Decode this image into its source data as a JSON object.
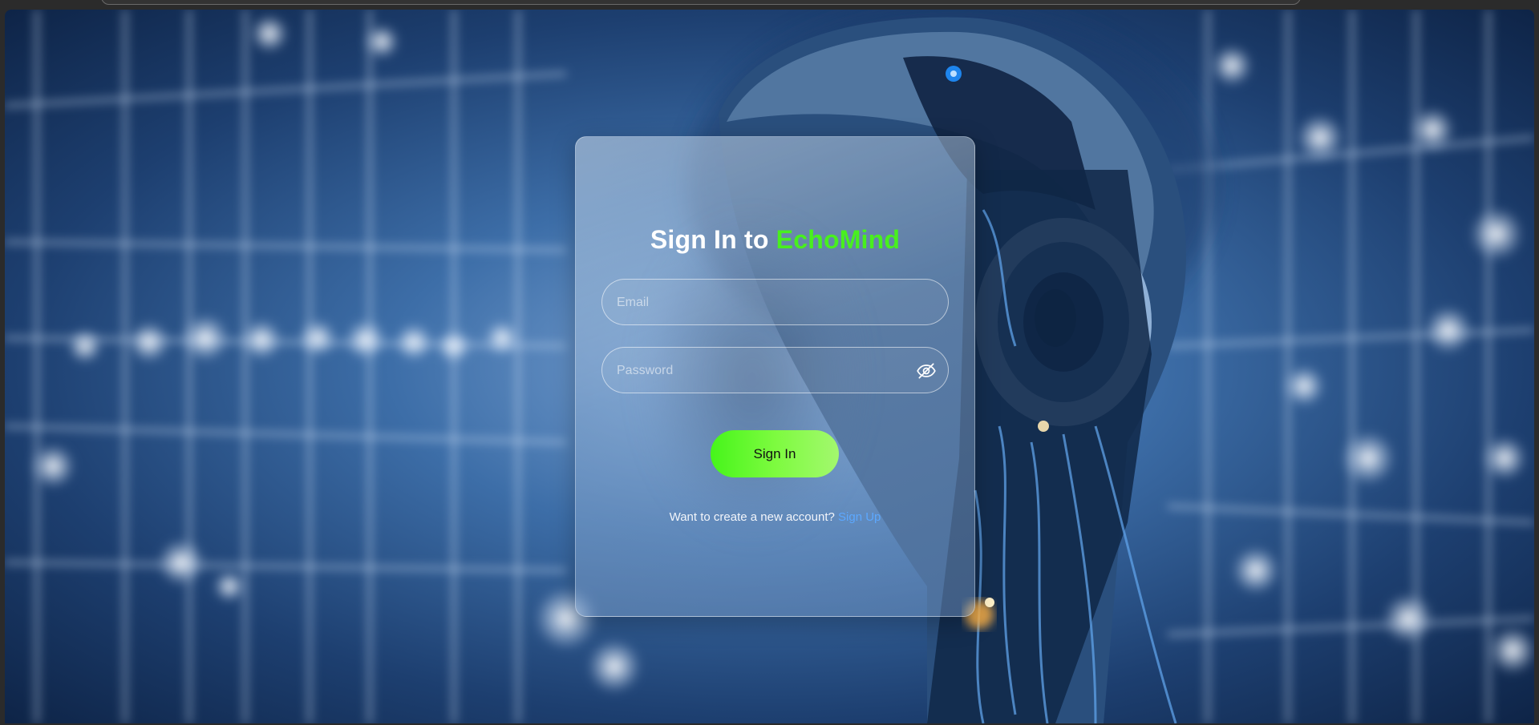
{
  "login": {
    "title_prefix": "Sign In to ",
    "brand_name": "EchoMind",
    "email_placeholder": "Email",
    "password_placeholder": "Password",
    "password_toggle_icon": "eye-slash-icon",
    "submit_label": "Sign In",
    "signup_prompt": "Want to create a new account?",
    "signup_link_label": "Sign Up"
  },
  "colors": {
    "brand_accent": "#48f01e",
    "button_gradient_start": "#46f51b",
    "button_gradient_end": "#a3f86e",
    "link": "#5ca8ff"
  }
}
